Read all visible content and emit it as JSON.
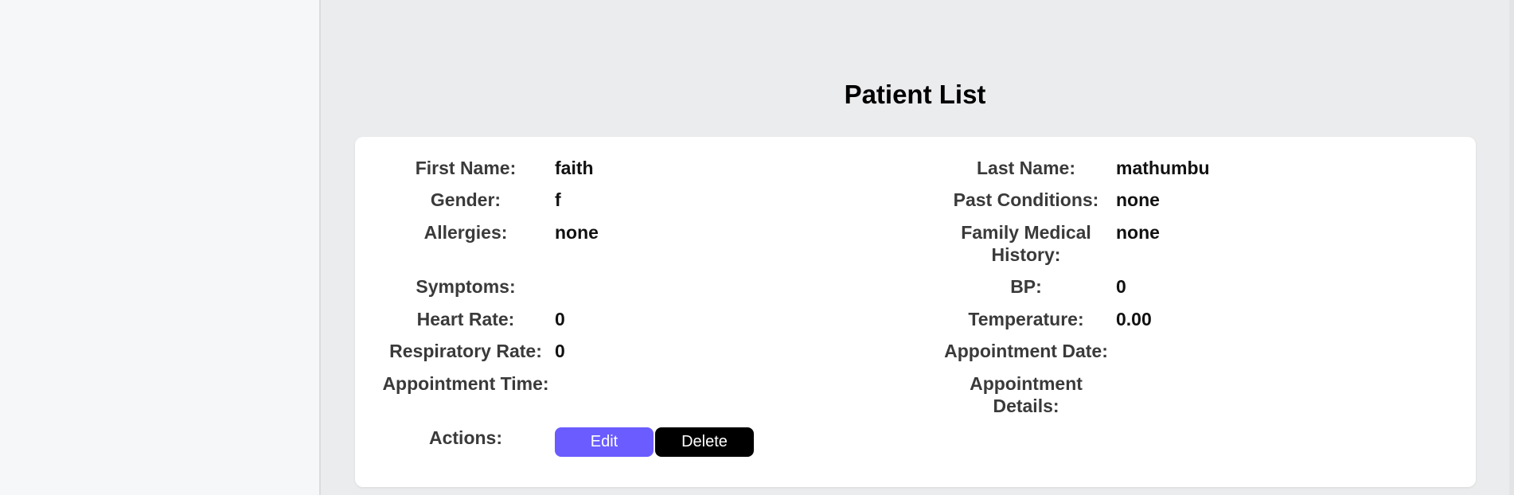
{
  "title": "Patient List",
  "labels": {
    "first_name": "First Name:",
    "last_name": "Last Name:",
    "gender": "Gender:",
    "past_conditions": "Past Conditions:",
    "allergies": "Allergies:",
    "family_history_line1": "Family Medical",
    "family_history_line2": "History:",
    "symptoms": "Symptoms:",
    "bp": "BP:",
    "heart_rate": "Heart Rate:",
    "temperature": "Temperature:",
    "respiratory_rate": "Respiratory Rate:",
    "appointment_date": "Appointment Date:",
    "appointment_time": "Appointment Time:",
    "appointment_details_line1": "Appointment",
    "appointment_details_line2": "Details:",
    "actions": "Actions:"
  },
  "patient": {
    "first_name": "faith",
    "last_name": "mathumbu",
    "gender": "f",
    "past_conditions": "none",
    "allergies": "none",
    "family_history": "none",
    "symptoms": "",
    "bp": "0",
    "heart_rate": "0",
    "temperature": "0.00",
    "respiratory_rate": "0",
    "appointment_date": "",
    "appointment_time": "",
    "appointment_details": ""
  },
  "buttons": {
    "edit": "Edit",
    "delete": "Delete"
  },
  "colors": {
    "edit_button": "#6a5cff",
    "delete_button": "#000000",
    "main_background": "#ebecee",
    "sidebar_background": "#f6f7f9"
  }
}
